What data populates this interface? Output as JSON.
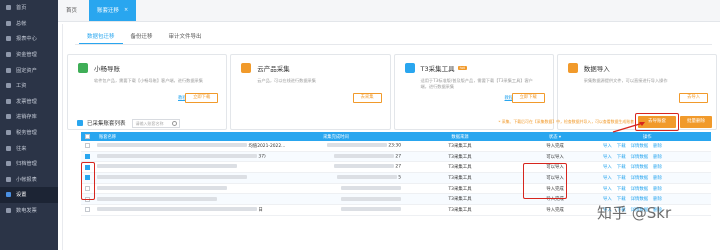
{
  "sidebar": {
    "items": [
      {
        "label": "首页",
        "icon": "home-icon"
      },
      {
        "label": "总帐",
        "icon": "ledger-icon"
      },
      {
        "label": "报表中心",
        "icon": "report-icon"
      },
      {
        "label": "资金管理",
        "icon": "money-icon"
      },
      {
        "label": "固定资产",
        "icon": "asset-icon"
      },
      {
        "label": "工资",
        "icon": "salary-icon"
      },
      {
        "label": "发票管理",
        "icon": "invoice-icon"
      },
      {
        "label": "进销存库",
        "icon": "stock-icon"
      },
      {
        "label": "税务管理",
        "icon": "tax-icon"
      },
      {
        "label": "往来",
        "icon": "contact-icon"
      },
      {
        "label": "归档管理",
        "icon": "archive-icon"
      },
      {
        "label": "小帐报表",
        "icon": "mini-report-icon"
      },
      {
        "label": "设置",
        "icon": "settings-icon"
      },
      {
        "label": "数电发票",
        "icon": "e-invoice-icon"
      }
    ],
    "active_index": 12
  },
  "page_tabs": [
    "首页",
    "账套迁移"
  ],
  "subtabs": [
    "数据包迁移",
    "备份迁移",
    "审计文件导出"
  ],
  "cards": [
    {
      "title": "小畅导账",
      "desc": "软件包产品，需要下载【小畅导账】客户端，进行数据采集",
      "link": "教程视频",
      "button": "立即下载",
      "color": "#3fae57",
      "badge": ""
    },
    {
      "title": "云产品采集",
      "desc": "云产品，可以在线进行数据采集",
      "link": "",
      "button": "去采集",
      "color": "#f19a2b",
      "badge": ""
    },
    {
      "title": "T3采集工具",
      "desc": "适用于T3标准版/普及版产品，需要下载【T3采集工具】客户端，进行数据采集",
      "link": "教程视频",
      "button": "立即下载",
      "color": "#29a6ef",
      "badge": "hot"
    },
    {
      "title": "数据导入",
      "desc": "采集数据源提供文件，可以直接进行导入操作",
      "link": "",
      "button": "去导入",
      "color": "#f19a2b",
      "badge": ""
    }
  ],
  "list": {
    "title": "已采集账套列表",
    "search_placeholder": "请输入账套名称",
    "tip": "* 采集、下载后可在【采集数据】中，检查数据并导入，可以查看数据生成账套",
    "download_button": "去导账套",
    "delete_button": "批量删除"
  },
  "table": {
    "headers": [
      "账套名称",
      "采集完成时间",
      "数据来源",
      "状态",
      "操作"
    ],
    "rows": [
      {
        "name_tail": "均值2021-2022...",
        "time": "23:30",
        "source": "T3采集工具",
        "status": "导入完成",
        "checked": false,
        "ops": [
          "导入",
          "下载",
          "详情数据",
          "删除"
        ]
      },
      {
        "name_tail": "37)",
        "time": "27",
        "source": "T3采集工具",
        "status": "可以导入",
        "checked": true,
        "ops": [
          "导入",
          "下载",
          "详情数据",
          "删除"
        ]
      },
      {
        "name_tail": "",
        "time": "27",
        "source": "T3采集工具",
        "status": "可以导入",
        "checked": true,
        "ops": [
          "导入",
          "下载",
          "详情数据",
          "删除"
        ]
      },
      {
        "name_tail": "",
        "time": "5",
        "source": "T3采集工具",
        "status": "可以导入",
        "checked": true,
        "ops": [
          "导入",
          "下载",
          "详情数据",
          "删除"
        ]
      },
      {
        "name_tail": "",
        "time": "",
        "source": "T3采集工具",
        "status": "导入完成",
        "checked": false,
        "ops": [
          "导入",
          "下载",
          "详情数据",
          "删除"
        ]
      },
      {
        "name_tail": "",
        "time": "",
        "source": "T3采集工具",
        "status": "导入完成",
        "checked": false,
        "ops": [
          "导入",
          "下载",
          "详情数据",
          "删除"
        ]
      },
      {
        "name_tail": "日",
        "time": "",
        "source": "T3采集工具",
        "status": "导入完成",
        "checked": false,
        "ops": [
          "导入",
          "下载",
          "详情数据",
          "删除"
        ]
      }
    ]
  },
  "watermark": "知乎 @Skr",
  "colors": {
    "accent": "#29a6ef",
    "orange": "#f19a2b",
    "highlight": "#d7261e",
    "sidebar": "#2b3447"
  }
}
